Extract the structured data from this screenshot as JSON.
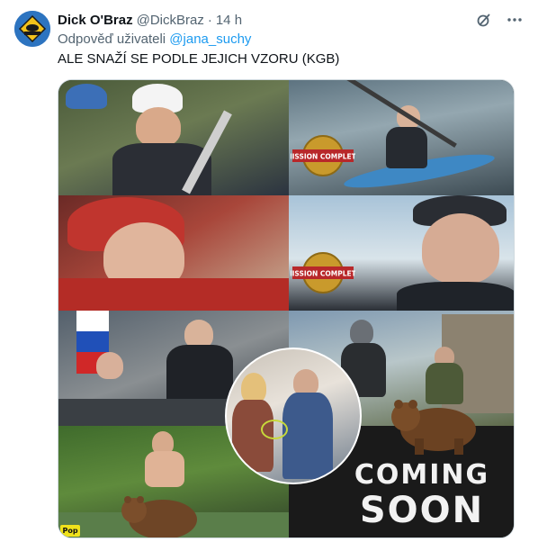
{
  "author": {
    "name": "Dick O'Braz",
    "handle": "@DickBraz",
    "separator": "·",
    "time": "14 h"
  },
  "actions": {
    "grok_icon": "grok-icon",
    "more_icon": "more-horizontal-icon"
  },
  "reply": {
    "prefix": "Odpověď uživateli",
    "mention": "@jana_suchy"
  },
  "tweet": {
    "text": "ALE SNAŽÍ SE PODLE JEJICH VZORU (KGB)"
  },
  "media": {
    "badge_text_top": "MISSION COMPLETE",
    "badge_text_bottom": "MISSION COMPLETE",
    "coming_line1": "COMING",
    "coming_line2": "SOON",
    "corner_logo": "Pop"
  },
  "colors": {
    "text": "#0f1419",
    "secondary": "#536471",
    "link": "#1d9bf0",
    "border": "#cfd9de"
  }
}
